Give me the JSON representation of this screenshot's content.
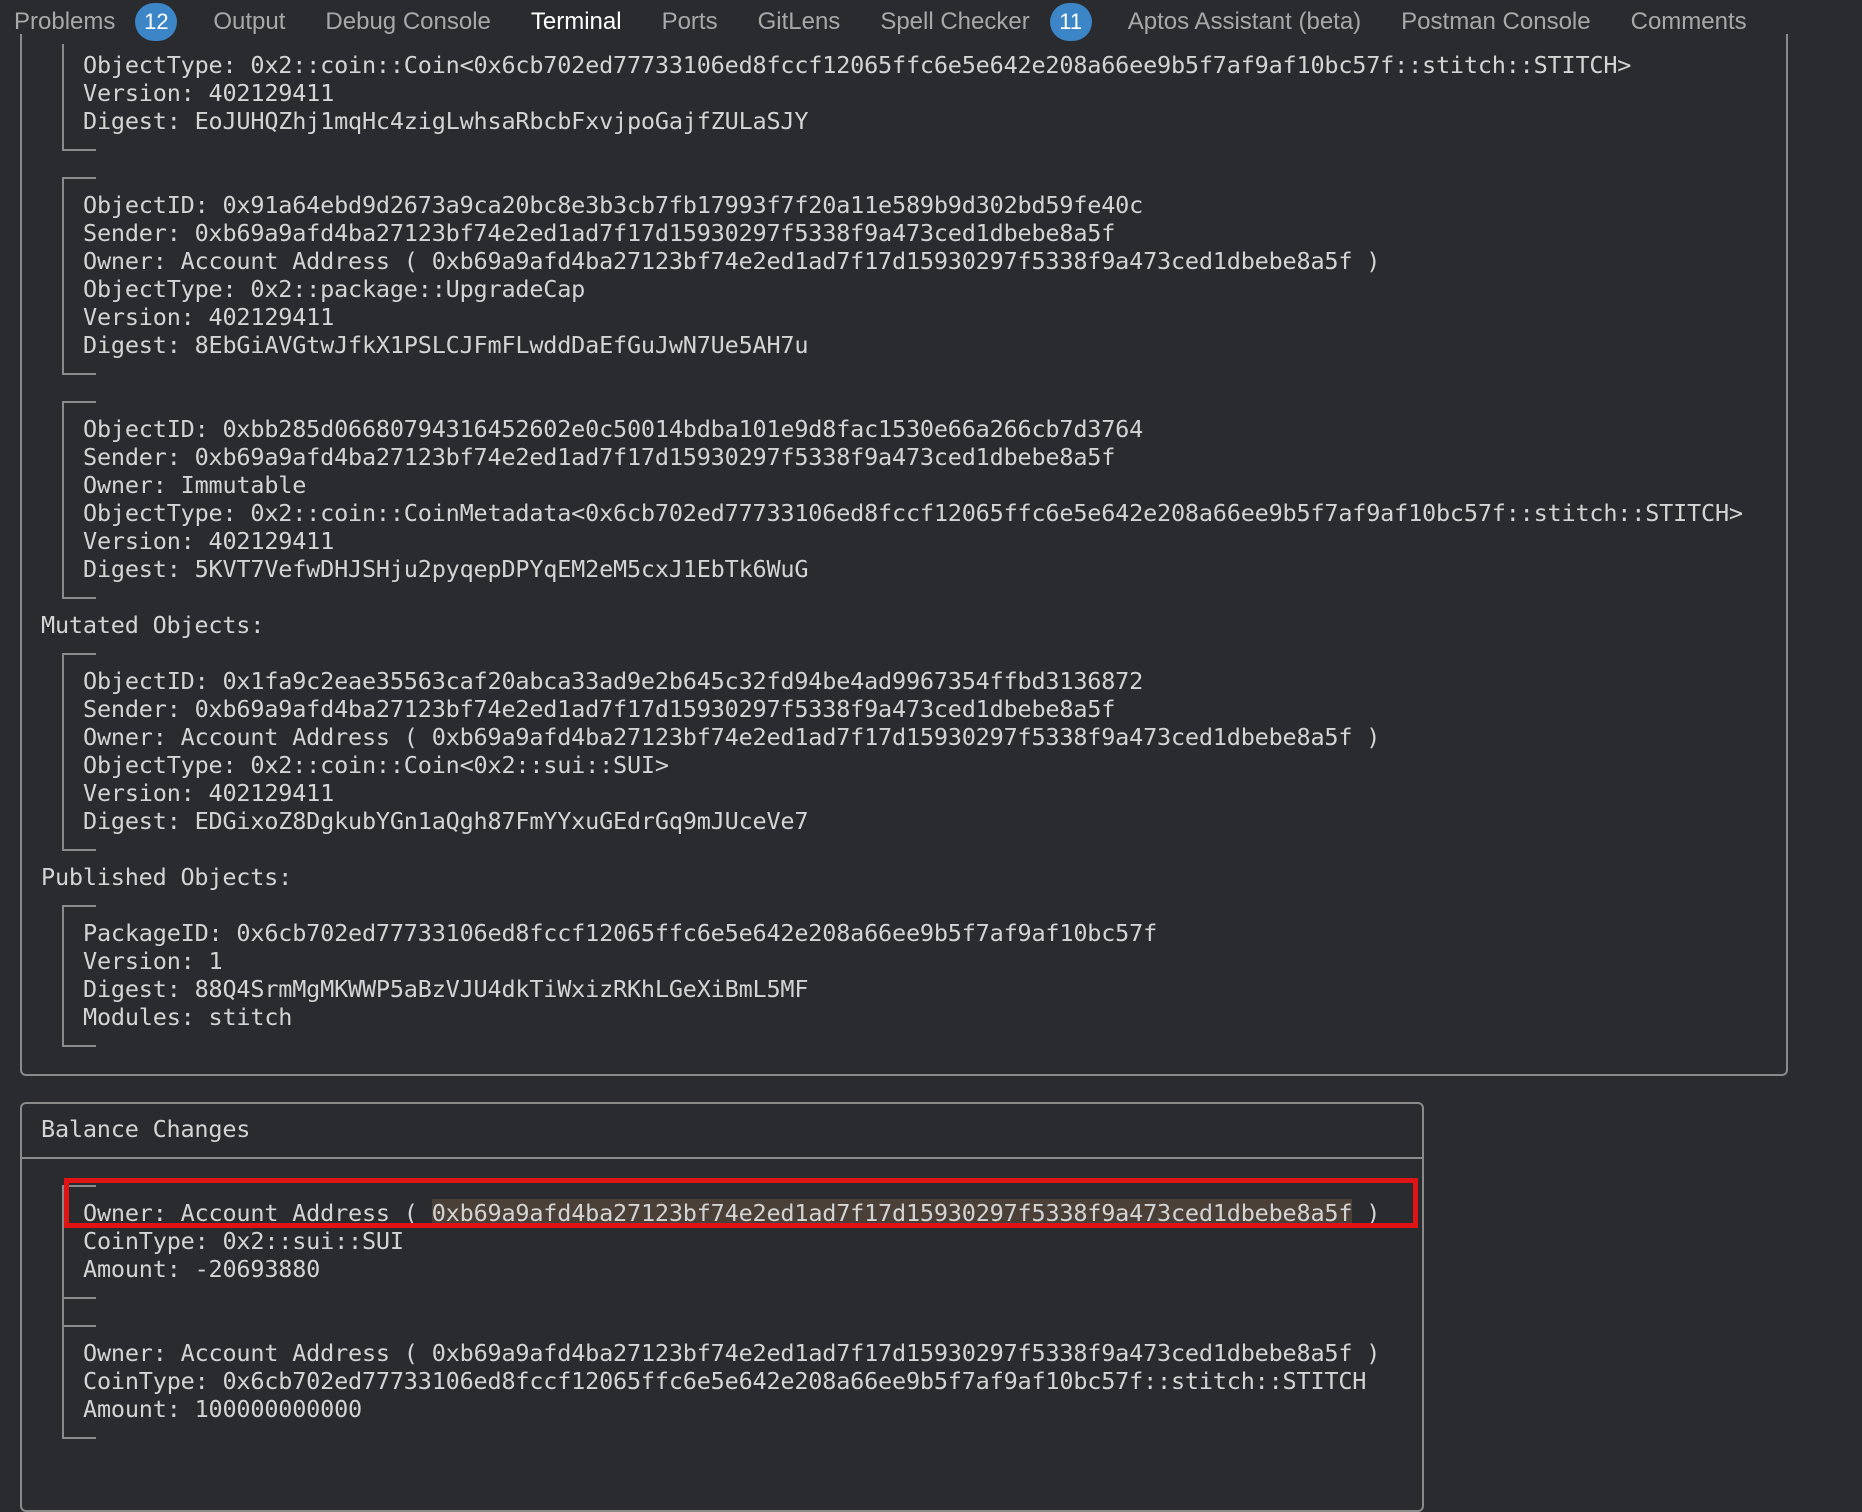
{
  "tabs": [
    {
      "label": "Problems",
      "badge": "12",
      "active": false
    },
    {
      "label": "Output",
      "badge": null,
      "active": false
    },
    {
      "label": "Debug Console",
      "badge": null,
      "active": false
    },
    {
      "label": "Terminal",
      "badge": null,
      "active": true
    },
    {
      "label": "Ports",
      "badge": null,
      "active": false
    },
    {
      "label": "GitLens",
      "badge": null,
      "active": false
    },
    {
      "label": "Spell Checker",
      "badge": "11",
      "active": false
    },
    {
      "label": "Aptos Assistant (beta)",
      "badge": null,
      "active": false
    },
    {
      "label": "Postman Console",
      "badge": null,
      "active": false
    },
    {
      "label": "Comments",
      "badge": null,
      "active": false
    }
  ],
  "colors": {
    "background": "#2a2b2e",
    "text": "#d4d4d4",
    "badge": "#3c85c6",
    "border": "#8a8a8a",
    "highlight_box": "#e01414"
  },
  "created_objects": [
    {
      "lines": [
        "ObjectType: 0x2::coin::Coin<0x6cb702ed77733106ed8fccf12065ffc6e5e642e208a66ee9b5f7af9af10bc57f::stitch::STITCH>",
        "Version: 402129411",
        "Digest: EoJUHQZhj1mqHc4zigLwhsaRbcbFxvjpoGajfZULaSJY"
      ]
    },
    {
      "lines": [
        "ObjectID: 0x91a64ebd9d2673a9ca20bc8e3b3cb7fb17993f7f20a11e589b9d302bd59fe40c",
        "Sender: 0xb69a9afd4ba27123bf74e2ed1ad7f17d15930297f5338f9a473ced1dbebe8a5f",
        "Owner: Account Address ( 0xb69a9afd4ba27123bf74e2ed1ad7f17d15930297f5338f9a473ced1dbebe8a5f )",
        "ObjectType: 0x2::package::UpgradeCap",
        "Version: 402129411",
        "Digest: 8EbGiAVGtwJfkX1PSLCJFmFLwddDaEfGuJwN7Ue5AH7u"
      ]
    },
    {
      "lines": [
        "ObjectID: 0xbb285d06680794316452602e0c50014bdba101e9d8fac1530e66a266cb7d3764",
        "Sender: 0xb69a9afd4ba27123bf74e2ed1ad7f17d15930297f5338f9a473ced1dbebe8a5f",
        "Owner: Immutable",
        "ObjectType: 0x2::coin::CoinMetadata<0x6cb702ed77733106ed8fccf12065ffc6e5e642e208a66ee9b5f7af9af10bc57f::stitch::STITCH>",
        "Version: 402129411",
        "Digest: 5KVT7VefwDHJSHju2pyqepDPYqEM2eM5cxJ1EbTk6WuG"
      ]
    }
  ],
  "mutated_heading": "Mutated Objects:",
  "mutated_objects": [
    {
      "lines": [
        "ObjectID: 0x1fa9c2eae35563caf20abca33ad9e2b645c32fd94be4ad9967354ffbd3136872",
        "Sender: 0xb69a9afd4ba27123bf74e2ed1ad7f17d15930297f5338f9a473ced1dbebe8a5f",
        "Owner: Account Address ( 0xb69a9afd4ba27123bf74e2ed1ad7f17d15930297f5338f9a473ced1dbebe8a5f )",
        "ObjectType: 0x2::coin::Coin<0x2::sui::SUI>",
        "Version: 402129411",
        "Digest: EDGixoZ8DgkubYGn1aQgh87FmYYxuGEdrGq9mJUceVe7"
      ]
    }
  ],
  "published_heading": "Published Objects:",
  "published_objects": [
    {
      "lines": [
        "PackageID: 0x6cb702ed77733106ed8fccf12065ffc6e5e642e208a66ee9b5f7af9af10bc57f",
        "Version: 1",
        "Digest: 88Q4SrmMgMKWWP5aBzVJU4dkTiWxizRKhLGeXiBmL5MF",
        "Modules: stitch"
      ]
    }
  ],
  "balance_changes": {
    "title": "Balance Changes",
    "entries": [
      {
        "owner_prefix": "Owner: Account Address ( ",
        "owner_address": "0xb69a9afd4ba27123bf74e2ed1ad7f17d15930297f5338f9a473ced1dbebe8a5f",
        "owner_suffix": " )",
        "coin_type": "CoinType: 0x2::sui::SUI",
        "amount": "Amount: -20693880"
      },
      {
        "owner_prefix": "Owner: Account Address ( ",
        "owner_address": "0xb69a9afd4ba27123bf74e2ed1ad7f17d15930297f5338f9a473ced1dbebe8a5f",
        "owner_suffix": " )",
        "coin_type": "CoinType: 0x6cb702ed77733106ed8fccf12065ffc6e5e642e208a66ee9b5f7af9af10bc57f::stitch::STITCH",
        "amount": "Amount: 100000000000"
      }
    ]
  }
}
